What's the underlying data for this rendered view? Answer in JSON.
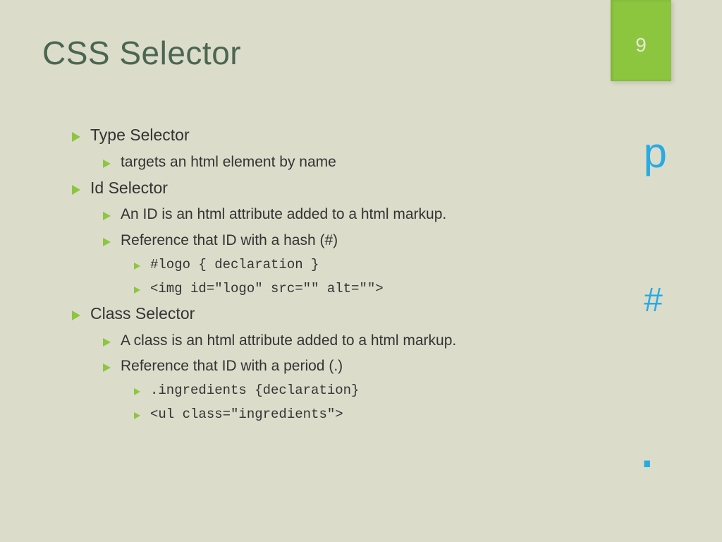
{
  "title": "CSS Selector",
  "page_number": "9",
  "side": {
    "p": "p",
    "hash": "#",
    "dot": "."
  },
  "b": {
    "type": "Type Selector",
    "type_sub": "targets an html element by name",
    "id": "Id Selector",
    "id_sub1": "An ID is an html attribute added to a html markup.",
    "id_sub2": "Reference that ID with a hash (#)",
    "id_code1": "#logo { declaration }",
    "id_code2": "<img id=\"logo\" src=\"\" alt=\"\">",
    "class": "Class Selector",
    "class_sub1": "A class is an html attribute added to a html markup.",
    "class_sub2": "Reference that ID with a period (.)",
    "class_code1": ".ingredients {declaration}",
    "class_code2": "<ul class=\"ingredients\">"
  }
}
